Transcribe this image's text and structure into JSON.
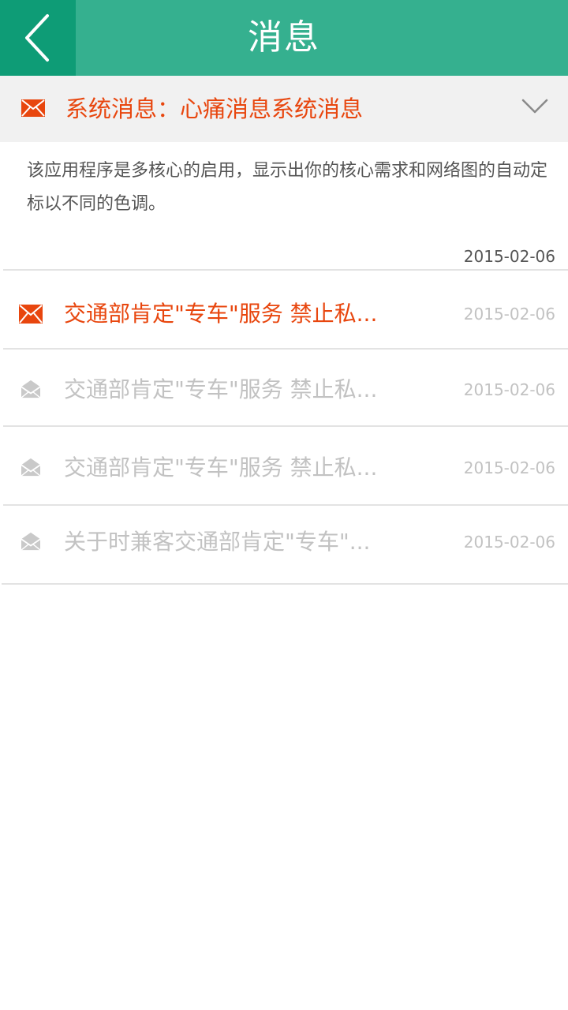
{
  "header": {
    "title": "消息",
    "back_icon": "chevron-left-icon"
  },
  "colors": {
    "header_bg": "#35b08f",
    "back_bg": "#0e9c76",
    "accent": "#e8460e",
    "muted": "#c2c2c2"
  },
  "system_message": {
    "icon": "envelope-icon",
    "title": "系统消息：心痛消息系统消息",
    "expand_icon": "chevron-down-icon",
    "body": "该应用程序是多核心的启用，显示出你的核心需求和网络图的自动定标以不同的色调。",
    "date": "2015-02-06"
  },
  "messages": [
    {
      "title": "交通部肯定\"专车\"服务 禁止私...",
      "date": "2015-02-06",
      "status": "unread",
      "icon": "envelope-icon"
    },
    {
      "title": "交通部肯定\"专车\"服务 禁止私...",
      "date": "2015-02-06",
      "status": "read",
      "icon": "open-envelope-icon"
    },
    {
      "title": "交通部肯定\"专车\"服务 禁止私...",
      "date": "2015-02-06",
      "status": "read",
      "icon": "open-envelope-icon"
    },
    {
      "title": "关于时兼客交通部肯定\"专车\"...",
      "date": "2015-02-06",
      "status": "read",
      "icon": "open-envelope-icon"
    }
  ]
}
